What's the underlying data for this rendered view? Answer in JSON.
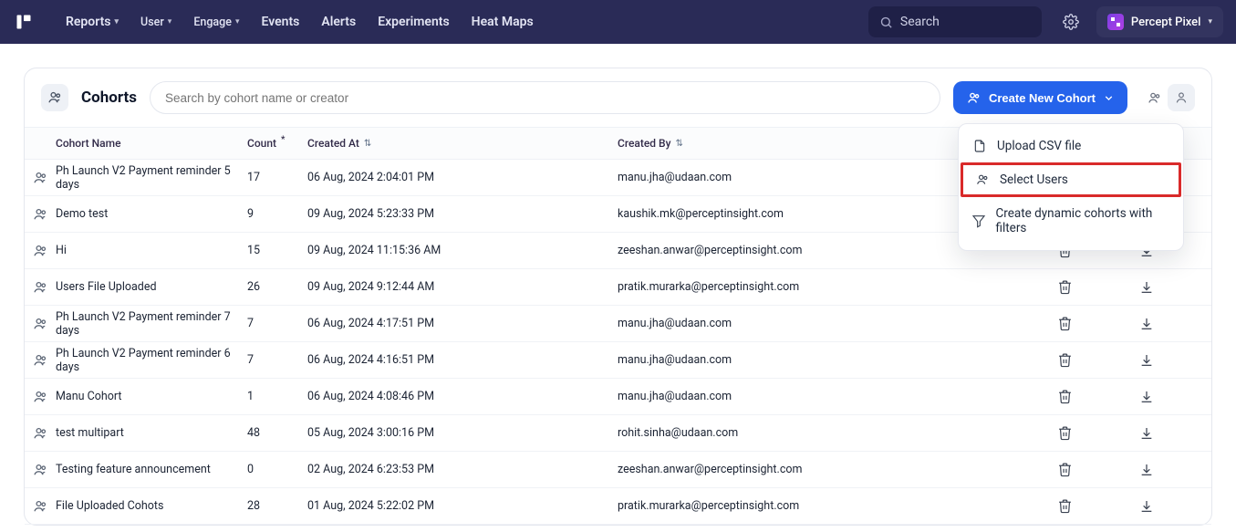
{
  "nav": {
    "reports": "Reports",
    "user": "User",
    "engage": "Engage",
    "events": "Events",
    "alerts": "Alerts",
    "experiments": "Experiments",
    "heatmaps": "Heat Maps"
  },
  "topbar": {
    "search_placeholder": "Search",
    "workspace": "Percept Pixel"
  },
  "page": {
    "title": "Cohorts",
    "search_placeholder": "Search by cohort name or creator",
    "create_label": "Create New Cohort"
  },
  "dropdown": {
    "items": [
      {
        "icon": "file",
        "label": "Upload CSV file"
      },
      {
        "icon": "cohort",
        "label": "Select Users"
      },
      {
        "icon": "filter",
        "label": "Create dynamic cohorts with filters"
      }
    ]
  },
  "table": {
    "headers": {
      "name": "Cohort Name",
      "count": "Count",
      "created_at": "Created At",
      "created_by": "Created By"
    },
    "rows": [
      {
        "name": "Ph Launch V2 Payment reminder 5 days",
        "count": "17",
        "created_at": "06 Aug, 2024 2:04:01 PM",
        "created_by": "manu.jha@udaan.com",
        "show_actions": false
      },
      {
        "name": "Demo test",
        "count": "9",
        "created_at": "09 Aug, 2024 5:23:33 PM",
        "created_by": "kaushik.mk@perceptinsight.com",
        "show_actions": false
      },
      {
        "name": "Hi",
        "count": "15",
        "created_at": "09 Aug, 2024 11:15:36 AM",
        "created_by": "zeeshan.anwar@perceptinsight.com",
        "show_actions": true
      },
      {
        "name": "Users File Uploaded",
        "count": "26",
        "created_at": "09 Aug, 2024 9:12:44 AM",
        "created_by": "pratik.murarka@perceptinsight.com",
        "show_actions": true
      },
      {
        "name": "Ph Launch V2 Payment reminder 7 days",
        "count": "7",
        "created_at": "06 Aug, 2024 4:17:51 PM",
        "created_by": "manu.jha@udaan.com",
        "show_actions": true
      },
      {
        "name": "Ph Launch V2 Payment reminder 6 days",
        "count": "7",
        "created_at": "06 Aug, 2024 4:16:51 PM",
        "created_by": "manu.jha@udaan.com",
        "show_actions": true
      },
      {
        "name": "Manu Cohort",
        "count": "1",
        "created_at": "06 Aug, 2024 4:08:46 PM",
        "created_by": "manu.jha@udaan.com",
        "show_actions": true
      },
      {
        "name": "test multipart",
        "count": "48",
        "created_at": "05 Aug, 2024 3:00:16 PM",
        "created_by": "rohit.sinha@udaan.com",
        "show_actions": true
      },
      {
        "name": "Testing feature announcement",
        "count": "0",
        "created_at": "02 Aug, 2024 6:23:53 PM",
        "created_by": "zeeshan.anwar@perceptinsight.com",
        "show_actions": true
      },
      {
        "name": "File Uploaded Cohots",
        "count": "28",
        "created_at": "01 Aug, 2024 5:22:02 PM",
        "created_by": "pratik.murarka@perceptinsight.com",
        "show_actions": true
      }
    ]
  }
}
